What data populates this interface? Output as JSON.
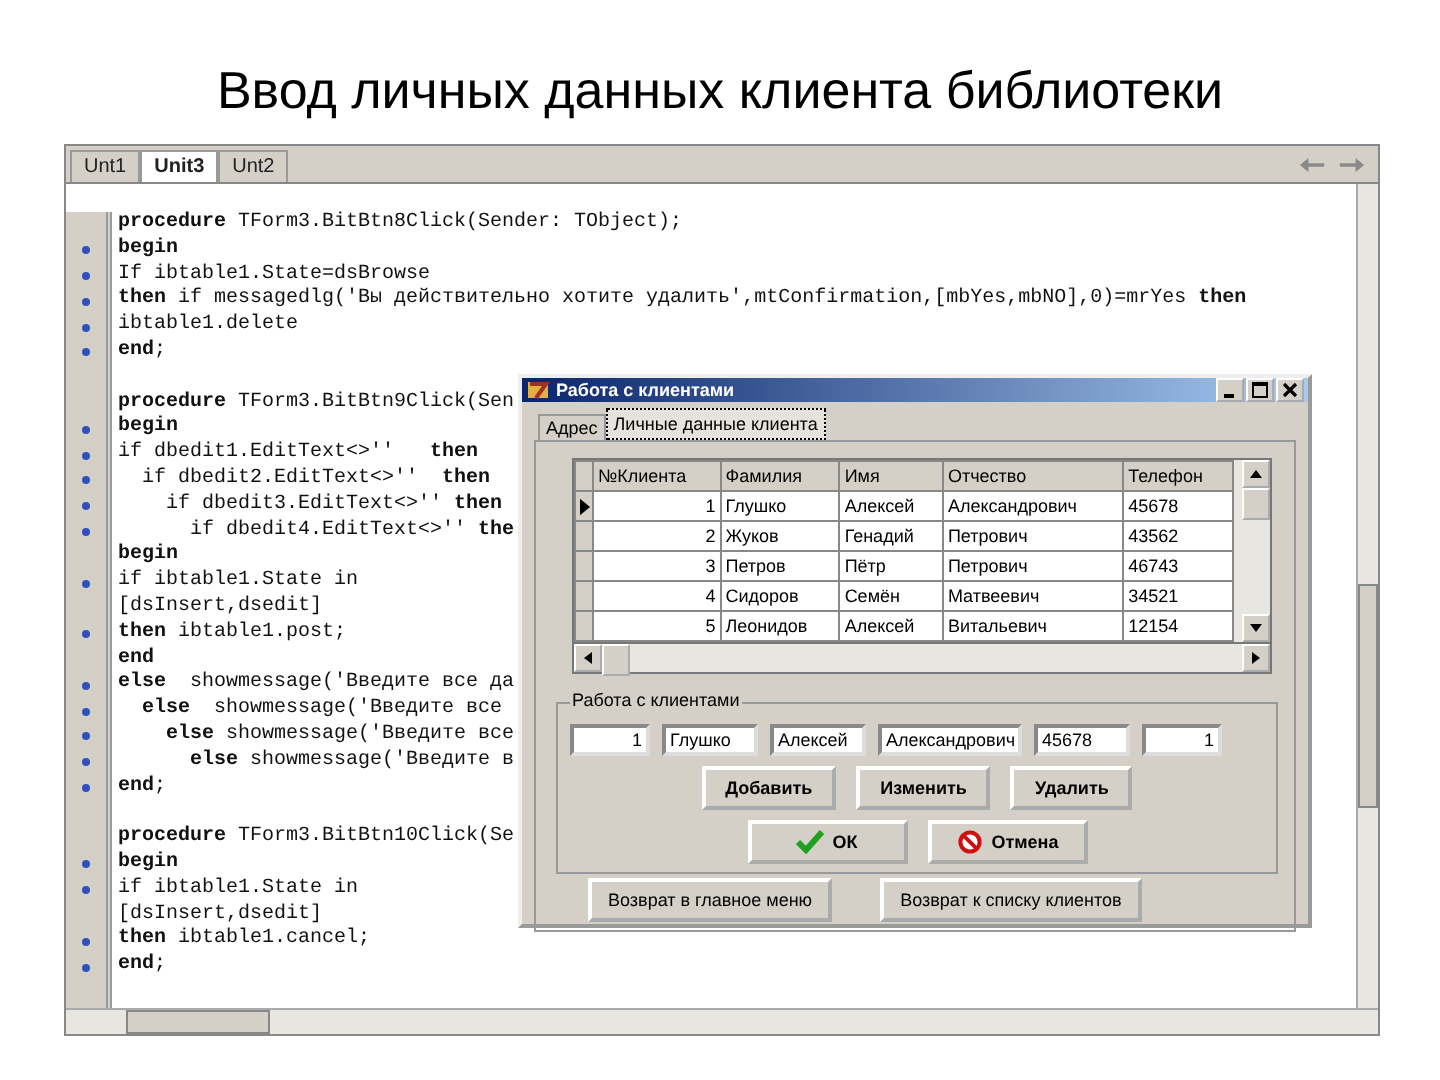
{
  "slide_title": "Ввод личных данных клиента библиотеки",
  "editor": {
    "tabs": [
      {
        "label": "Unt1",
        "selected": false
      },
      {
        "label": "Unit3",
        "selected": true
      },
      {
        "label": "Unt2",
        "selected": false
      }
    ],
    "blocks": [
      {
        "lines": [
          {
            "text": "**procedure** TForm3.BitBtn8Click(Sender: TObject);",
            "executable": false
          },
          {
            "text": "**begin**",
            "executable": true
          },
          {
            "text": "If ibtable1.State=dsBrowse",
            "executable": true
          },
          {
            "text": "**then** if messagedlg('Вы действительно хотите удалить',mtConfirmation,[mbYes,mbNO],0)=mrYes **then**",
            "executable": true
          },
          {
            "text": "ibtable1.delete",
            "executable": true
          },
          {
            "text": "**end**;",
            "executable": true
          }
        ]
      },
      {
        "lines": [
          {
            "text": "**procedure** TForm3.BitBtn9Click(Sen",
            "executable": false
          },
          {
            "text": "**begin**",
            "executable": true
          },
          {
            "text": "if dbedit1.EditText<>''   **then**",
            "executable": true
          },
          {
            "text": "  if dbedit2.EditText<>''  **then**",
            "executable": true
          },
          {
            "text": "    if dbedit3.EditText<>'' **then**",
            "executable": true
          },
          {
            "text": "      if dbedit4.EditText<>'' **the**",
            "executable": true
          },
          {
            "text": "**begin**",
            "executable": false
          },
          {
            "text": "if ibtable1.State in",
            "executable": true
          },
          {
            "text": "[dsInsert,dsedit]",
            "executable": false
          },
          {
            "text": "**then** ibtable1.post;",
            "executable": true
          },
          {
            "text": "**end**",
            "executable": false
          },
          {
            "text": "**else**  showmessage('Введите все да",
            "executable": true
          },
          {
            "text": "  **else**  showmessage('Введите все",
            "executable": true
          },
          {
            "text": "    **else** showmessage('Введите все",
            "executable": true
          },
          {
            "text": "      **else** showmessage('Введите в",
            "executable": true
          },
          {
            "text": "**end**;",
            "executable": true
          }
        ]
      },
      {
        "lines": [
          {
            "text": "**procedure** TForm3.BitBtn10Click(Se",
            "executable": false
          },
          {
            "text": "**begin**",
            "executable": true
          },
          {
            "text": "if ibtable1.State in",
            "executable": true
          },
          {
            "text": "[dsInsert,dsedit]",
            "executable": false
          },
          {
            "text": "**then** ibtable1.cancel;",
            "executable": true
          },
          {
            "text": "**end**;",
            "executable": true
          }
        ]
      }
    ]
  },
  "dialog": {
    "title": "Работа с клиентами",
    "tabs": [
      {
        "label": "Адрес",
        "selected": false
      },
      {
        "label": "Личные данные клиента",
        "selected": true
      }
    ],
    "table": {
      "columns": [
        "№Клиента",
        "Фамилия",
        "Имя",
        "Отчество",
        "Телефон"
      ],
      "rows": [
        {
          "cells": [
            "1",
            "Глушко",
            "Алексей",
            "Александрович",
            "45678"
          ],
          "selected": true
        },
        {
          "cells": [
            "2",
            "Жуков",
            "Генадий",
            "Петрович",
            "43562"
          ],
          "selected": false
        },
        {
          "cells": [
            "3",
            "Петров",
            "Пётр",
            "Петрович",
            "46743"
          ],
          "selected": false
        },
        {
          "cells": [
            "4",
            "Сидоров",
            "Семён",
            "Матвеевич",
            "34521"
          ],
          "selected": false
        },
        {
          "cells": [
            "5",
            "Леонидов",
            "Алексей",
            "Витальевич",
            "12154"
          ],
          "selected": false
        }
      ]
    },
    "group": {
      "title": "Работа с клиентами",
      "fields": [
        "1",
        "Глушко",
        "Алексей",
        "Александрович",
        "45678",
        "1"
      ],
      "buttons": [
        "Добавить",
        "Изменить",
        "Удалить"
      ],
      "ok_button": "ОК",
      "cancel_button": "Отмена"
    },
    "nav_buttons": [
      "Возврат в главное меню",
      "Возврат к списку клиентов"
    ]
  }
}
